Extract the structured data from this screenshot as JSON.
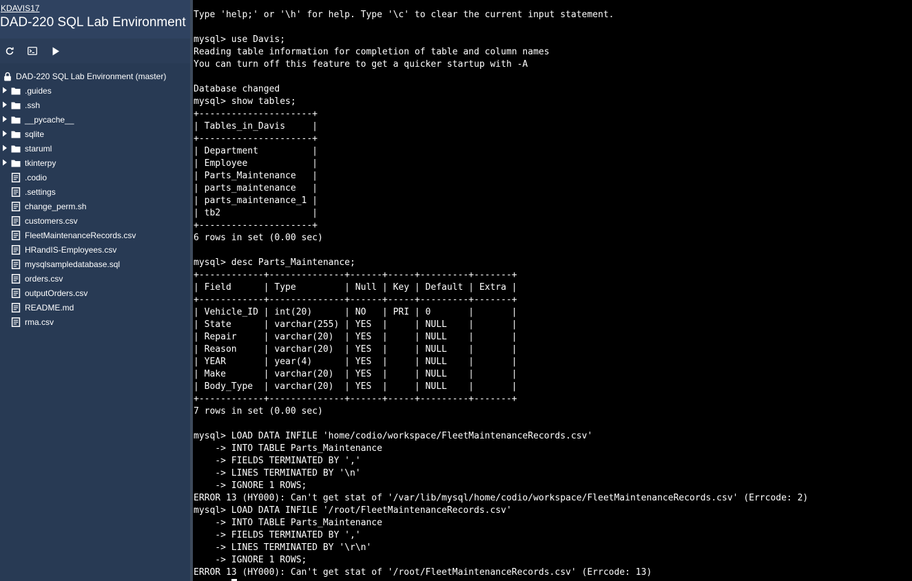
{
  "sidebar": {
    "username": "KDAVIS17",
    "project_title": "DAD-220 SQL Lab Environment",
    "toolbar": [
      {
        "name": "refresh-icon"
      },
      {
        "name": "terminal-icon"
      },
      {
        "name": "play-icon"
      }
    ],
    "tree_root_label": "DAD-220 SQL Lab Environment (master)",
    "items": [
      {
        "label": ".guides",
        "type": "folder"
      },
      {
        "label": ".ssh",
        "type": "folder"
      },
      {
        "label": "__pycache__",
        "type": "folder"
      },
      {
        "label": "sqlite",
        "type": "folder"
      },
      {
        "label": "staruml",
        "type": "folder"
      },
      {
        "label": "tkinterpy",
        "type": "folder"
      },
      {
        "label": ".codio",
        "type": "file"
      },
      {
        "label": ".settings",
        "type": "file"
      },
      {
        "label": "change_perm.sh",
        "type": "file"
      },
      {
        "label": "customers.csv",
        "type": "file"
      },
      {
        "label": "FleetMaintenanceRecords.csv",
        "type": "file"
      },
      {
        "label": "HRandIS-Employees.csv",
        "type": "file"
      },
      {
        "label": "mysqlsampledatabase.sql",
        "type": "file"
      },
      {
        "label": "orders.csv",
        "type": "file"
      },
      {
        "label": "outputOrders.csv",
        "type": "file"
      },
      {
        "label": "README.md",
        "type": "file"
      },
      {
        "label": "rma.csv",
        "type": "file"
      }
    ]
  },
  "terminal": {
    "lines": [
      "Type 'help;' or '\\h' for help. Type '\\c' to clear the current input statement.",
      "",
      "mysql> use Davis;",
      "Reading table information for completion of table and column names",
      "You can turn off this feature to get a quicker startup with -A",
      "",
      "Database changed",
      "mysql> show tables;",
      "+---------------------+",
      "| Tables_in_Davis     |",
      "+---------------------+",
      "| Department          |",
      "| Employee            |",
      "| Parts_Maintenance   |",
      "| parts_maintenance   |",
      "| parts_maintenance_1 |",
      "| tb2                 |",
      "+---------------------+",
      "6 rows in set (0.00 sec)",
      "",
      "mysql> desc Parts_Maintenance;",
      "+------------+--------------+------+-----+---------+-------+",
      "| Field      | Type         | Null | Key | Default | Extra |",
      "+------------+--------------+------+-----+---------+-------+",
      "| Vehicle_ID | int(20)      | NO   | PRI | 0       |       |",
      "| State      | varchar(255) | YES  |     | NULL    |       |",
      "| Repair     | varchar(20)  | YES  |     | NULL    |       |",
      "| Reason     | varchar(20)  | YES  |     | NULL    |       |",
      "| YEAR       | year(4)      | YES  |     | NULL    |       |",
      "| Make       | varchar(20)  | YES  |     | NULL    |       |",
      "| Body_Type  | varchar(20)  | YES  |     | NULL    |       |",
      "+------------+--------------+------+-----+---------+-------+",
      "7 rows in set (0.00 sec)",
      "",
      "mysql> LOAD DATA INFILE 'home/codio/workspace/FleetMaintenanceRecords.csv'",
      "    -> INTO TABLE Parts_Maintenance",
      "    -> FIELDS TERMINATED BY ','",
      "    -> LINES TERMINATED BY '\\n'",
      "    -> IGNORE 1 ROWS;",
      "ERROR 13 (HY000): Can't get stat of '/var/lib/mysql/home/codio/workspace/FleetMaintenanceRecords.csv' (Errcode: 2)",
      "mysql> LOAD DATA INFILE '/root/FleetMaintenanceRecords.csv'",
      "    -> INTO TABLE Parts_Maintenance",
      "    -> FIELDS TERMINATED BY ','",
      "    -> LINES TERMINATED BY '\\r\\n'",
      "    -> IGNORE 1 ROWS;",
      "ERROR 13 (HY000): Can't get stat of '/root/FleetMaintenanceRecords.csv' (Errcode: 13)"
    ]
  },
  "colors": {
    "sidebar_bg": "#283a54",
    "terminal_bg": "#000000",
    "terminal_fg": "#ffffff"
  }
}
